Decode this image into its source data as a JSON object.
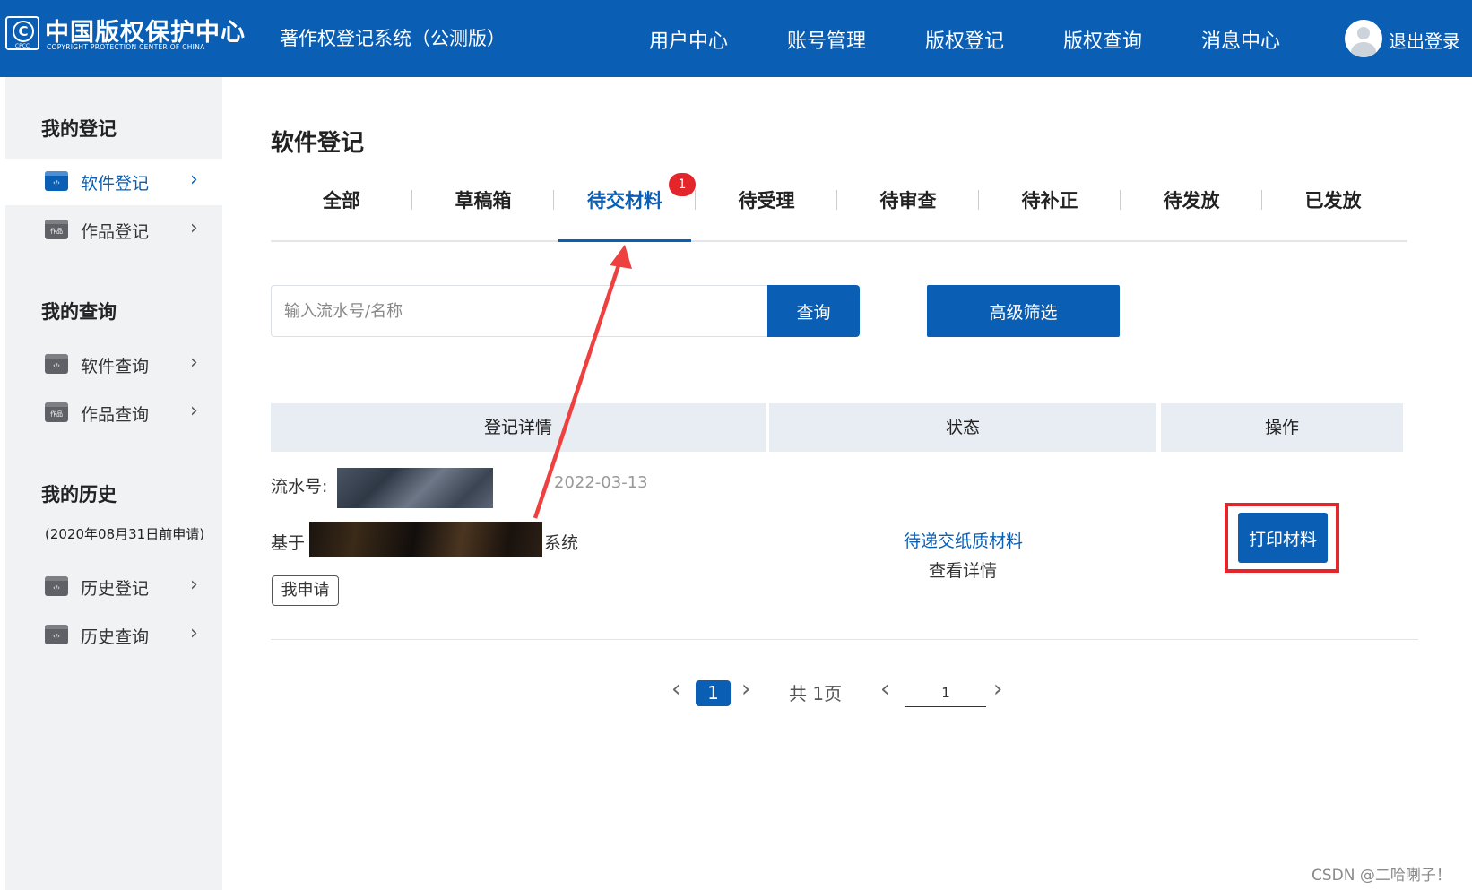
{
  "header": {
    "logo_mark": "C",
    "logo_mark_sub": "CPCC",
    "logo_cn": "中国版权保护中心",
    "logo_en": "COPYRIGHT PROTECTION CENTER OF CHINA",
    "system_title": "著作权登记系统（公测版）",
    "nav": [
      "用户中心",
      "账号管理",
      "版权登记",
      "版权查询",
      "消息中心"
    ],
    "logout_label": "退出登录",
    "bg_color": "#0a5fb4"
  },
  "sidebar": {
    "sections": [
      {
        "title": "我的登记",
        "items": [
          {
            "label": "软件登记",
            "icon": "software-code-icon",
            "active": true
          },
          {
            "label": "作品登记",
            "icon": "works-icon",
            "active": false
          }
        ]
      },
      {
        "title": "我的查询",
        "items": [
          {
            "label": "软件查询",
            "icon": "software-code-icon",
            "active": false
          },
          {
            "label": "作品查询",
            "icon": "works-icon",
            "active": false
          }
        ]
      },
      {
        "title": "我的历史",
        "note": "(2020年08月31日前申请)",
        "items": [
          {
            "label": "历史登记",
            "icon": "software-code-icon",
            "active": false
          },
          {
            "label": "历史查询",
            "icon": "software-code-icon",
            "active": false
          }
        ]
      }
    ],
    "icon_text_code": "‹/›",
    "icon_text_works": "作品",
    "chevron": "›"
  },
  "main": {
    "page_title": "软件登记",
    "tabs": [
      {
        "label": "全部",
        "active": false
      },
      {
        "label": "草稿箱",
        "active": false
      },
      {
        "label": "待交材料",
        "active": true,
        "badge": "1"
      },
      {
        "label": "待受理",
        "active": false
      },
      {
        "label": "待审查",
        "active": false
      },
      {
        "label": "待补正",
        "active": false
      },
      {
        "label": "待发放",
        "active": false
      },
      {
        "label": "已发放",
        "active": false
      }
    ],
    "search": {
      "placeholder": "输入流水号/名称",
      "value": "",
      "button": "查询"
    },
    "advanced_filter": "高级筛选",
    "table": {
      "headers": [
        "登记详情",
        "状态",
        "操作"
      ],
      "row": {
        "serial_label": "流水号:",
        "date": "2022-03-13",
        "name_prefix": "基于",
        "name_suffix": "系统",
        "tag": "我申请",
        "status": "待递交纸质材料",
        "detail_link": "查看详情",
        "action": "打印材料"
      }
    },
    "pagination": {
      "prev": "‹",
      "next": "›",
      "current_page": "1",
      "total_text": "共 1页",
      "jump_value": "1"
    }
  },
  "watermark": "CSDN @二哈喇子！",
  "accent_color": "#0a5fb4",
  "highlight_color": "#e3262b"
}
